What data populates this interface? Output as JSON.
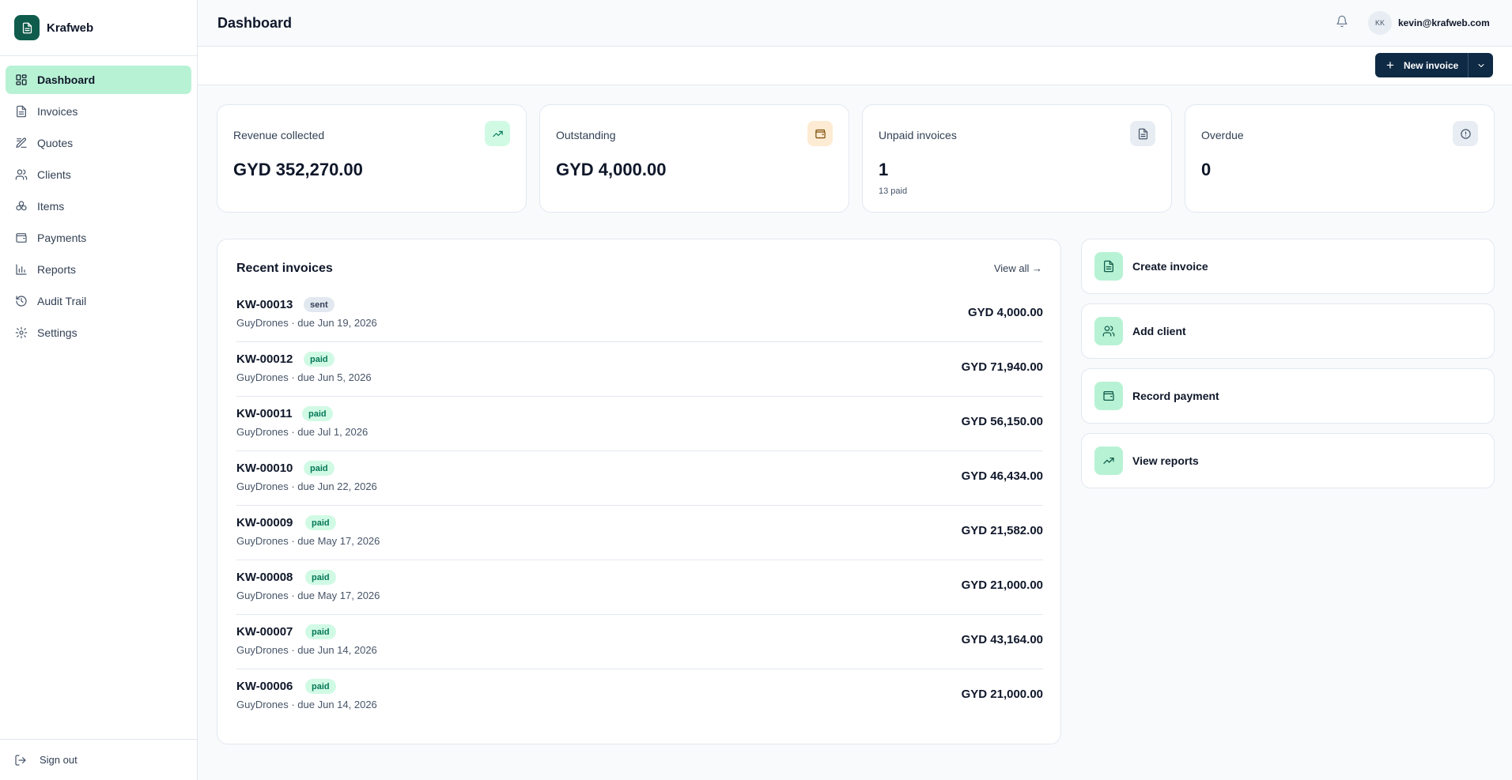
{
  "brand": {
    "name": "Krafweb",
    "icon": "document-icon",
    "color": "#0f5c4c"
  },
  "sidebar": {
    "items": [
      {
        "label": "Dashboard",
        "icon": "dashboard-icon",
        "active": true
      },
      {
        "label": "Invoices",
        "icon": "invoice-icon"
      },
      {
        "label": "Quotes",
        "icon": "quote-icon"
      },
      {
        "label": "Clients",
        "icon": "users-icon"
      },
      {
        "label": "Items",
        "icon": "items-icon"
      },
      {
        "label": "Payments",
        "icon": "wallet-icon"
      },
      {
        "label": "Reports",
        "icon": "chart-icon"
      },
      {
        "label": "Audit Trail",
        "icon": "history-icon"
      },
      {
        "label": "Settings",
        "icon": "gear-icon"
      }
    ],
    "signout_label": "Sign out"
  },
  "header": {
    "title": "Dashboard",
    "avatar_initials": "KK",
    "user_email": "kevin@krafweb.com"
  },
  "toolbar": {
    "new_invoice_label": "New invoice",
    "accent": "#0f2a44"
  },
  "stats": [
    {
      "label": "Revenue collected",
      "value": "GYD 352,270.00",
      "icon": "trending-up-icon"
    },
    {
      "label": "Outstanding",
      "value": "GYD 4,000.00",
      "icon": "wallet-icon"
    },
    {
      "label": "Unpaid invoices",
      "value": "1",
      "sub": "13 paid",
      "icon": "document-icon"
    },
    {
      "label": "Overdue",
      "value": "0",
      "icon": "alert-circle-icon"
    }
  ],
  "recent": {
    "title": "Recent invoices",
    "view_all": "View all →",
    "invoices": [
      {
        "number": "KW-00013",
        "status": "sent",
        "meta": "GuyDrones · due Jun 19, 2026",
        "amount": "GYD 4,000.00"
      },
      {
        "number": "KW-00012",
        "status": "paid",
        "meta": "GuyDrones · due Jun 5, 2026",
        "amount": "GYD 71,940.00"
      },
      {
        "number": "KW-00011",
        "status": "paid",
        "meta": "GuyDrones · due Jul 1, 2026",
        "amount": "GYD 56,150.00"
      },
      {
        "number": "KW-00010",
        "status": "paid",
        "meta": "GuyDrones · due Jun 22, 2026",
        "amount": "GYD 46,434.00"
      },
      {
        "number": "KW-00009",
        "status": "paid",
        "meta": "GuyDrones · due May 17, 2026",
        "amount": "GYD 21,582.00"
      },
      {
        "number": "KW-00008",
        "status": "paid",
        "meta": "GuyDrones · due May 17, 2026",
        "amount": "GYD 21,000.00"
      },
      {
        "number": "KW-00007",
        "status": "paid",
        "meta": "GuyDrones · due Jun 14, 2026",
        "amount": "GYD 43,164.00"
      },
      {
        "number": "KW-00006",
        "status": "paid",
        "meta": "GuyDrones · due Jun 14, 2026",
        "amount": "GYD 21,000.00"
      }
    ]
  },
  "actions": [
    {
      "label": "Create invoice",
      "icon": "document-icon"
    },
    {
      "label": "Add client",
      "icon": "users-icon"
    },
    {
      "label": "Record payment",
      "icon": "wallet-icon"
    },
    {
      "label": "View reports",
      "icon": "trending-up-icon"
    }
  ],
  "colors": {
    "active_nav": "#b8f2d4",
    "paid_badge": "#d1fae5",
    "sent_badge": "#e2e8f0"
  }
}
